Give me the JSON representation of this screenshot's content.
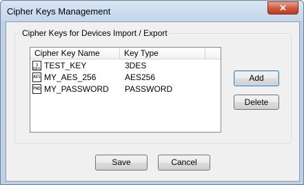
{
  "window": {
    "title": "Cipher Keys Management",
    "close_glyph": "✕"
  },
  "group": {
    "label": "Cipher Keys for Devices Import / Export"
  },
  "table": {
    "columns": [
      "Cipher Key Name",
      "Key Type"
    ],
    "rows": [
      {
        "icon": "3des-key-icon",
        "icon_text": "3 DES",
        "name": "TEST_KEY",
        "type": "3DES"
      },
      {
        "icon": "aes-key-icon",
        "icon_text": "AES",
        "name": "MY_AES_256",
        "type": "AES256"
      },
      {
        "icon": "password-key-icon",
        "icon_text": "PWD",
        "name": "MY_PASSWORD",
        "type": "PASSWORD"
      }
    ]
  },
  "buttons": {
    "add": "Add",
    "delete": "Delete",
    "save": "Save",
    "cancel": "Cancel"
  }
}
